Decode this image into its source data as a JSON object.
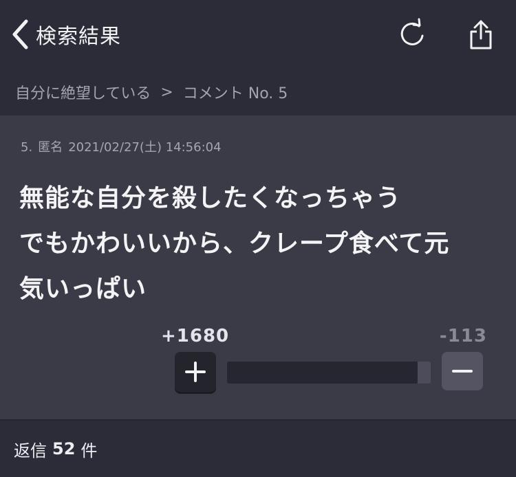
{
  "nav": {
    "back_label": "検索結果",
    "icons": {
      "back": "chevron-left-icon",
      "reload": "reload-icon",
      "share": "share-icon"
    }
  },
  "breadcrumb": {
    "parent": "自分に絶望している",
    "separator": ">",
    "current": "コメント No. 5"
  },
  "comment": {
    "number": "5.",
    "author": "匿名",
    "datetime": "2021/02/27(土) 14:56:04",
    "lines": [
      "無能な自分を殺したくなっちゃう",
      "でもかわいいから、クレープ食べて元",
      "気いっぱい"
    ],
    "plus_count": "+1680",
    "minus_count": "-113",
    "plus_ratio": 0.937
  },
  "replies": {
    "label": "返信",
    "count": "52",
    "unit": "件"
  },
  "colors": {
    "background": "#2c2c38",
    "card": "#3b3b48",
    "plus_button": "#24242c",
    "minus_button": "#545462"
  }
}
